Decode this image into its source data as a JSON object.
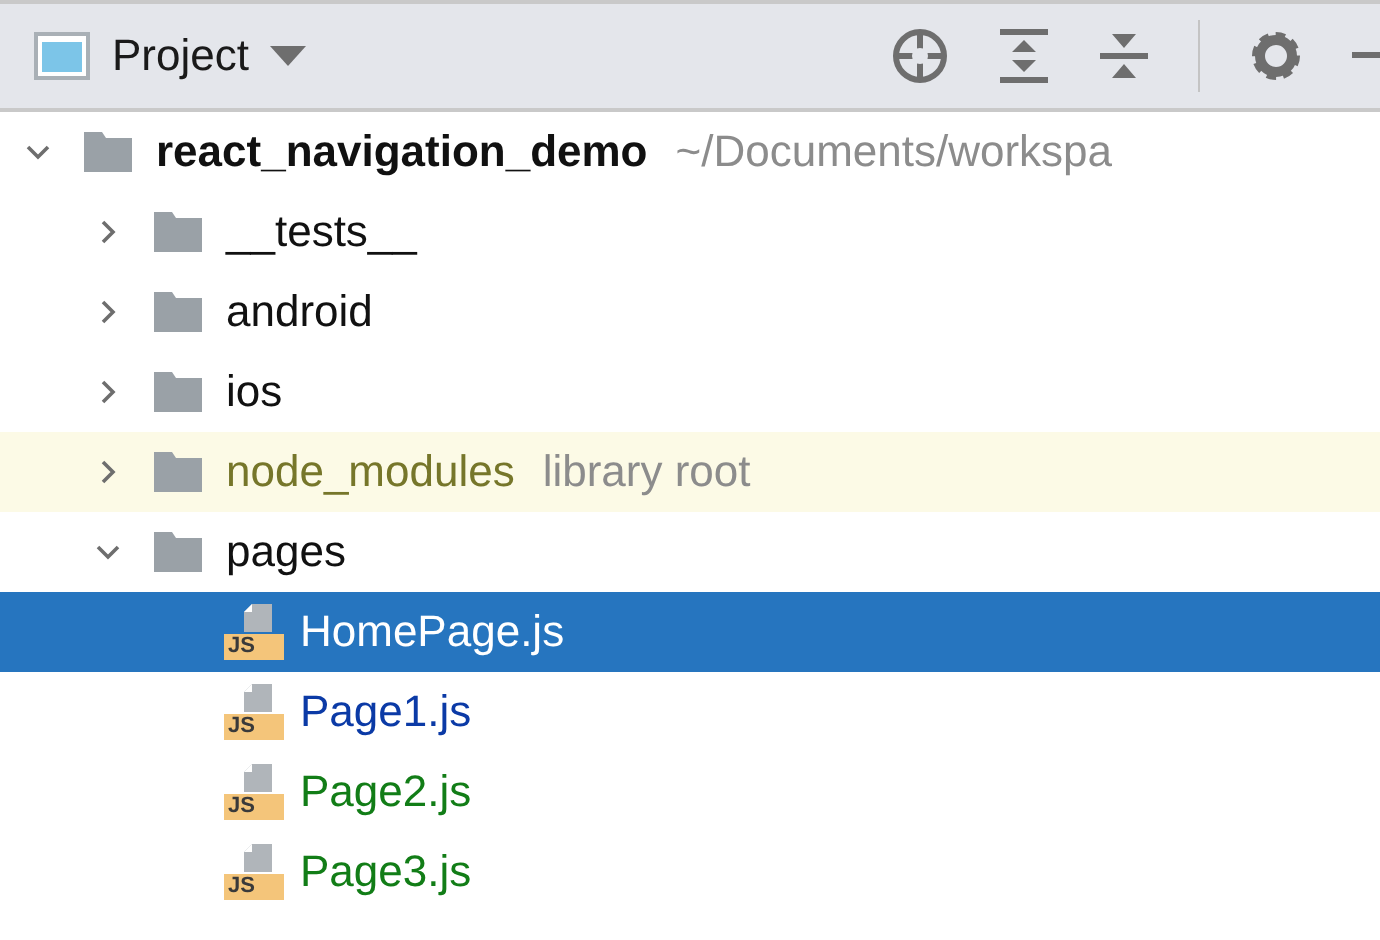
{
  "toolbar": {
    "title": "Project"
  },
  "tree": [
    {
      "kind": "folder",
      "name": "react_navigation_demo",
      "path": "~/Documents/workspa",
      "root": true,
      "expanded": true,
      "selected": false,
      "children": [
        {
          "kind": "folder",
          "name": "__tests__",
          "expanded": false,
          "selected": false
        },
        {
          "kind": "folder",
          "name": "android",
          "expanded": false,
          "selected": false
        },
        {
          "kind": "folder",
          "name": "ios",
          "expanded": false,
          "selected": false
        },
        {
          "kind": "folder",
          "name": "node_modules",
          "note": "library root",
          "library": true,
          "color": "#76762a",
          "expanded": false,
          "selected": false
        },
        {
          "kind": "folder",
          "name": "pages",
          "expanded": true,
          "selected": false,
          "children": [
            {
              "kind": "file",
              "name": "HomePage.js",
              "badge": "JS",
              "selected": true
            },
            {
              "kind": "file",
              "name": "Page1.js",
              "badge": "JS",
              "color": "#0b3aa6",
              "selected": false
            },
            {
              "kind": "file",
              "name": "Page2.js",
              "badge": "JS",
              "color": "#127d17",
              "selected": false
            },
            {
              "kind": "file",
              "name": "Page3.js",
              "badge": "JS",
              "color": "#127d17",
              "selected": false
            }
          ]
        }
      ]
    }
  ]
}
